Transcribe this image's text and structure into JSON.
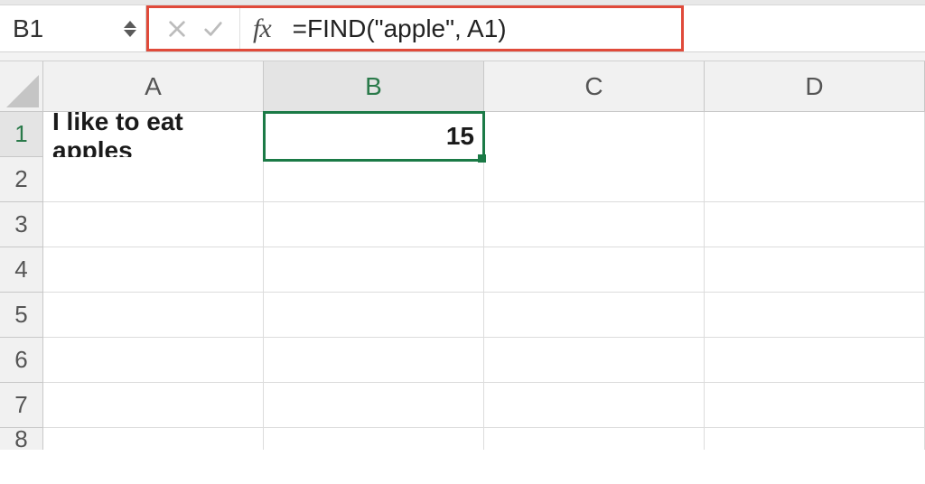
{
  "nameBox": "B1",
  "formula": "=FIND(\"apple\", A1)",
  "fxSymbol": "fx",
  "columns": [
    "A",
    "B",
    "C",
    "D"
  ],
  "activeColIndex": 1,
  "rows": [
    "1",
    "2",
    "3",
    "4",
    "5",
    "6",
    "7",
    "8"
  ],
  "activeRowIndex": 0,
  "cells": {
    "A1": "I like to eat apples",
    "B1": "15"
  },
  "selectedCell": "B1"
}
